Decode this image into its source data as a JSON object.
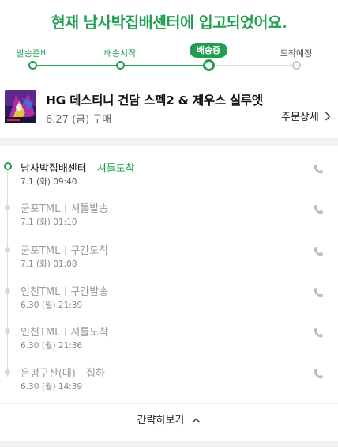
{
  "headline": "현재 남사박집배센터에 입고되었어요.",
  "progress": {
    "steps": [
      {
        "label": "발송준비",
        "state": "done"
      },
      {
        "label": "배송시작",
        "state": "done"
      },
      {
        "label": "배송중",
        "state": "current"
      },
      {
        "label": "도착예정",
        "state": "pending"
      }
    ]
  },
  "product": {
    "thumb_icon": "product-thumbnail",
    "name": "HG 데스티니 건담 스펙2 & 제우스 실루엣",
    "date": "6.27 (금) 구매",
    "order_detail_label": "주문상세"
  },
  "tracking": {
    "entries": [
      {
        "location": "남사박집배센터",
        "status": "셔틀도착",
        "time": "7.1 (화) 09:40",
        "active": true
      },
      {
        "location": "군포TML",
        "status": "셔틀발송",
        "time": "7.1 (화) 01:10",
        "active": false
      },
      {
        "location": "군포TML",
        "status": "구간도착",
        "time": "7.1 (화) 01:08",
        "active": false
      },
      {
        "location": "인천TML",
        "status": "구간발송",
        "time": "6.30 (월) 21:39",
        "active": false
      },
      {
        "location": "인천TML",
        "status": "셔틀도착",
        "time": "6.30 (월) 21:36",
        "active": false
      },
      {
        "location": "은평구산(대)",
        "status": "집하",
        "time": "6.30 (월) 14:39",
        "active": false
      }
    ]
  },
  "collapse_label": "간략히보기",
  "colors": {
    "accent": "#1f9e4f",
    "muted": "#999999",
    "separator": "#f2f2f2"
  }
}
